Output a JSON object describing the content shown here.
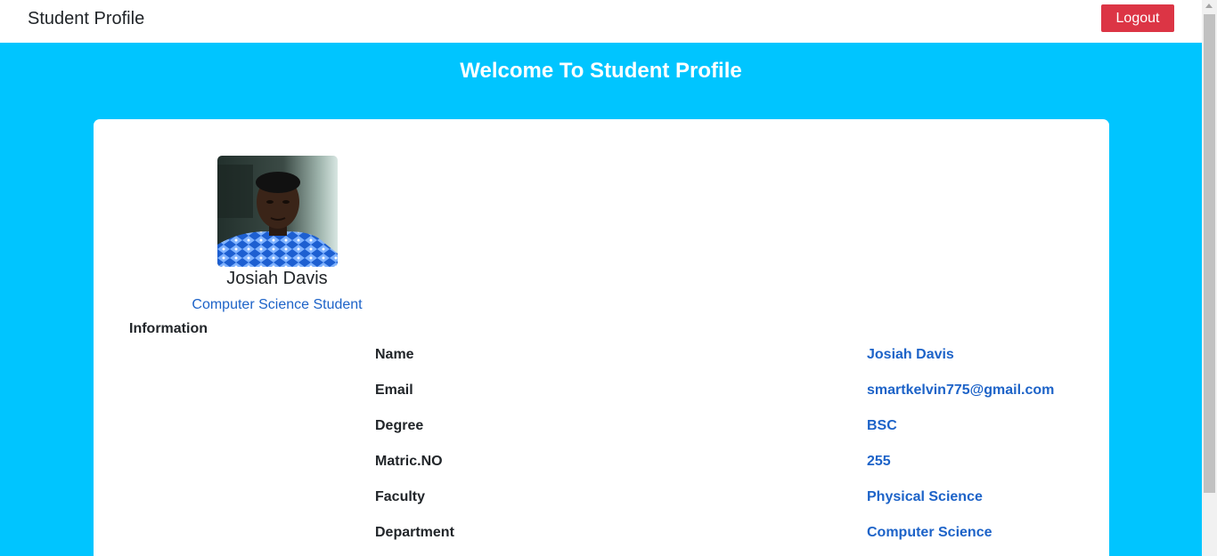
{
  "navbar": {
    "brand": "Student Profile",
    "logout_label": "Logout"
  },
  "hero": {
    "title": "Welcome To Student Profile"
  },
  "profile": {
    "name": "Josiah Davis",
    "role": "Computer Science Student",
    "information_heading": "Information",
    "fields": [
      {
        "label": "Name",
        "value": "Josiah Davis"
      },
      {
        "label": "Email",
        "value": "smartkelvin775@gmail.com"
      },
      {
        "label": "Degree",
        "value": "BSC"
      },
      {
        "label": "Matric.NO",
        "value": "255"
      },
      {
        "label": "Faculty",
        "value": "Physical Science"
      },
      {
        "label": "Department",
        "value": "Computer Science"
      }
    ]
  },
  "colors": {
    "header_bg": "#00c5ff",
    "logout_bg": "#dc3545",
    "accent_text": "#1d63c8"
  }
}
